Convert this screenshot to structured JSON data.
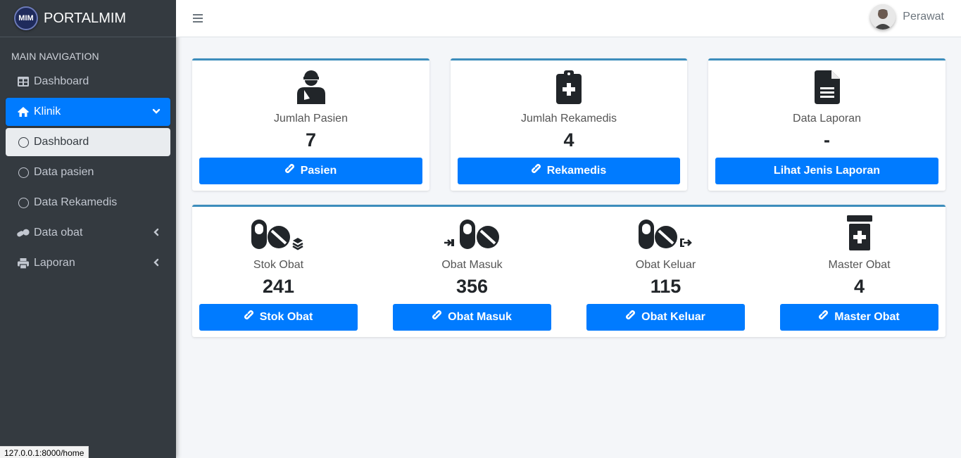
{
  "brand": {
    "logo_text": "MIM",
    "name_bold": "PORTAL",
    "name_light": "MIM"
  },
  "sidebar": {
    "header": "MAIN NAVIGATION",
    "items": [
      {
        "label": "Dashboard",
        "icon": "table-icon"
      },
      {
        "label": "Klinik",
        "icon": "home-icon",
        "caret": "chevron-down-icon"
      },
      {
        "label": "Dashboard",
        "icon": "circle-icon"
      },
      {
        "label": "Data pasien",
        "icon": "circle-icon"
      },
      {
        "label": "Data Rekamedis",
        "icon": "circle-icon"
      },
      {
        "label": "Data obat",
        "icon": "pills-icon",
        "caret": "chevron-left-icon"
      },
      {
        "label": "Laporan",
        "icon": "print-icon",
        "caret": "chevron-left-icon"
      }
    ]
  },
  "navbar": {
    "user_name": "Perawat"
  },
  "top_cards": [
    {
      "label": "Jumlah Pasien",
      "value": "7",
      "button": "Pasien",
      "icon": "user-injured-icon"
    },
    {
      "label": "Jumlah Rekamedis",
      "value": "4",
      "button": "Rekamedis",
      "icon": "clipboard-medical-icon"
    },
    {
      "label": "Data Laporan",
      "value": "-",
      "button": "Lihat Jenis Laporan",
      "icon": "file-icon"
    }
  ],
  "bottom_cards": [
    {
      "label": "Stok Obat",
      "value": "241",
      "button": "Stok Obat",
      "icon": "pills-stock-icon"
    },
    {
      "label": "Obat Masuk",
      "value": "356",
      "button": "Obat Masuk",
      "icon": "pills-in-icon"
    },
    {
      "label": "Obat Keluar",
      "value": "115",
      "button": "Obat Keluar",
      "icon": "pills-out-icon"
    },
    {
      "label": "Master Obat",
      "value": "4",
      "button": "Master Obat",
      "icon": "prescription-bottle-icon"
    }
  ],
  "statusbar": {
    "url": "127.0.0.1:8000/home"
  },
  "colors": {
    "sidebar_bg": "#343a40",
    "primary": "#007bff",
    "card_top_border": "#3c8dbc",
    "page_bg": "#f4f6f9"
  }
}
